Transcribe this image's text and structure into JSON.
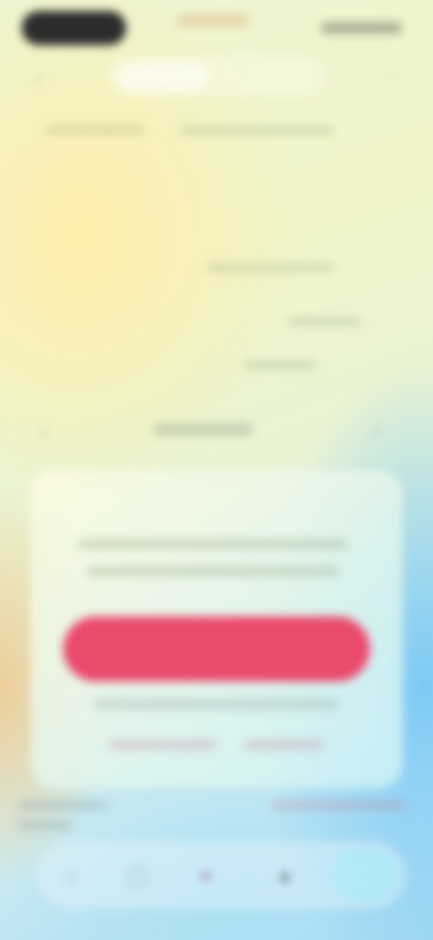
{
  "top_tabs": [
    {
      "label": "",
      "active": true
    },
    {
      "label": "",
      "active": false
    }
  ],
  "sheet": {
    "title": "",
    "message": "",
    "primary_button": "",
    "secondary_text": ""
  },
  "icons": {
    "back": "chevron-left-icon",
    "more": "more-icon",
    "tabbar": [
      "home-icon",
      "discover-icon",
      "create-icon",
      "profile-icon"
    ]
  },
  "colors": {
    "primary_button": "#ea4a6c",
    "status_pill": "#2c2c2c"
  }
}
